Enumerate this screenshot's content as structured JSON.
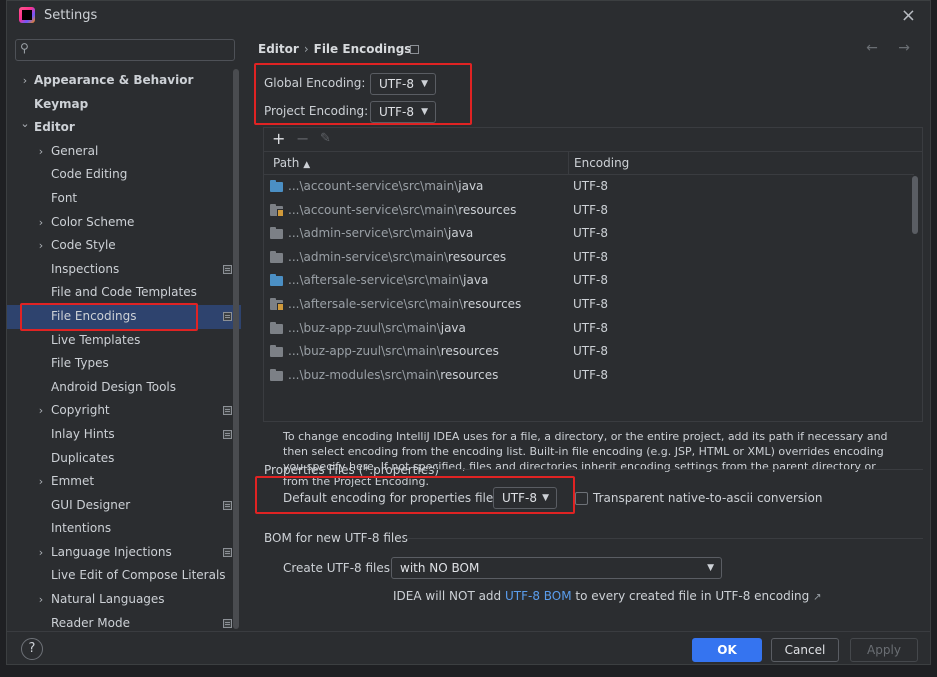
{
  "window": {
    "title": "Settings",
    "close_label": "×"
  },
  "search": {
    "placeholder": "",
    "icon": "search-icon"
  },
  "sidebar": {
    "items": [
      {
        "label": "Appearance & Behavior",
        "level": 0,
        "chevron": "›",
        "bold": true
      },
      {
        "label": "Keymap",
        "level": 0,
        "chevron": "",
        "bold": true
      },
      {
        "label": "Editor",
        "level": 0,
        "chevron": "⌄",
        "bold": true
      },
      {
        "label": "General",
        "level": 1,
        "chevron": "›"
      },
      {
        "label": "Code Editing",
        "level": 1,
        "chevron": ""
      },
      {
        "label": "Font",
        "level": 1,
        "chevron": ""
      },
      {
        "label": "Color Scheme",
        "level": 1,
        "chevron": "›"
      },
      {
        "label": "Code Style",
        "level": 1,
        "chevron": "›"
      },
      {
        "label": "Inspections",
        "level": 1,
        "chevron": "",
        "doc": true
      },
      {
        "label": "File and Code Templates",
        "level": 1,
        "chevron": ""
      },
      {
        "label": "File Encodings",
        "level": 1,
        "chevron": "",
        "doc": true,
        "selected": true
      },
      {
        "label": "Live Templates",
        "level": 1,
        "chevron": ""
      },
      {
        "label": "File Types",
        "level": 1,
        "chevron": ""
      },
      {
        "label": "Android Design Tools",
        "level": 1,
        "chevron": ""
      },
      {
        "label": "Copyright",
        "level": 1,
        "chevron": "›",
        "doc": true
      },
      {
        "label": "Inlay Hints",
        "level": 1,
        "chevron": "",
        "doc": true
      },
      {
        "label": "Duplicates",
        "level": 1,
        "chevron": ""
      },
      {
        "label": "Emmet",
        "level": 1,
        "chevron": "›"
      },
      {
        "label": "GUI Designer",
        "level": 1,
        "chevron": "",
        "doc": true
      },
      {
        "label": "Intentions",
        "level": 1,
        "chevron": ""
      },
      {
        "label": "Language Injections",
        "level": 1,
        "chevron": "›",
        "doc": true
      },
      {
        "label": "Live Edit of Compose Literals",
        "level": 1,
        "chevron": ""
      },
      {
        "label": "Natural Languages",
        "level": 1,
        "chevron": "›"
      },
      {
        "label": "Reader Mode",
        "level": 1,
        "chevron": "",
        "doc": true
      }
    ]
  },
  "breadcrumb": {
    "parent": "Editor",
    "separator": "›",
    "current": "File Encodings",
    "arrows": "← →"
  },
  "global_encoding": {
    "label": "Global Encoding:",
    "value": "UTF-8"
  },
  "project_encoding": {
    "label": "Project Encoding:",
    "value": "UTF-8"
  },
  "table": {
    "toolbar": {
      "add": "+",
      "remove": "−",
      "edit": "✎"
    },
    "col_path": "Path",
    "sort_indicator": "▲",
    "col_encoding": "Encoding",
    "rows": [
      {
        "prefix": "...\\account-service\\src\\main\\",
        "leaf": "java",
        "encoding": "UTF-8",
        "type": "src"
      },
      {
        "prefix": "...\\account-service\\src\\main\\",
        "leaf": "resources",
        "encoding": "UTF-8",
        "type": "res"
      },
      {
        "prefix": "...\\admin-service\\src\\main\\",
        "leaf": "java",
        "encoding": "UTF-8",
        "type": "plain"
      },
      {
        "prefix": "...\\admin-service\\src\\main\\",
        "leaf": "resources",
        "encoding": "UTF-8",
        "type": "plain"
      },
      {
        "prefix": "...\\aftersale-service\\src\\main\\",
        "leaf": "java",
        "encoding": "UTF-8",
        "type": "src"
      },
      {
        "prefix": "...\\aftersale-service\\src\\main\\",
        "leaf": "resources",
        "encoding": "UTF-8",
        "type": "res"
      },
      {
        "prefix": "...\\buz-app-zuul\\src\\main\\",
        "leaf": "java",
        "encoding": "UTF-8",
        "type": "plain"
      },
      {
        "prefix": "...\\buz-app-zuul\\src\\main\\",
        "leaf": "resources",
        "encoding": "UTF-8",
        "type": "plain"
      },
      {
        "prefix": "...\\buz-modules\\src\\main\\",
        "leaf": "resources",
        "encoding": "UTF-8",
        "type": "plain"
      }
    ]
  },
  "description": "To change encoding IntelliJ IDEA uses for a file, a directory, or the entire project, add its path if necessary and then select encoding from the encoding list. Built-in file encoding (e.g. JSP, HTML or XML) overrides encoding you specify here. If not specified, files and directories inherit encoding settings from the parent directory or from the Project Encoding.",
  "properties": {
    "section_title": "Properties Files (*.properties)",
    "default_label": "Default encoding for properties files:",
    "default_value": "UTF-8",
    "transparent_label": "Transparent native-to-ascii conversion",
    "transparent_checked": false
  },
  "bom": {
    "section_title": "BOM for new UTF-8 files",
    "create_label": "Create UTF-8 files:",
    "create_value": "with NO BOM",
    "note_prefix": "IDEA will NOT add ",
    "note_link": "UTF-8 BOM",
    "note_suffix": " to every created file in UTF-8 encoding",
    "note_ext": "↗"
  },
  "footer": {
    "help": "?",
    "ok": "OK",
    "cancel": "Cancel",
    "apply": "Apply"
  },
  "colors": {
    "accent": "#3574f0",
    "selection": "#2e436e",
    "highlight": "#e02323",
    "link": "#5a9ded"
  }
}
